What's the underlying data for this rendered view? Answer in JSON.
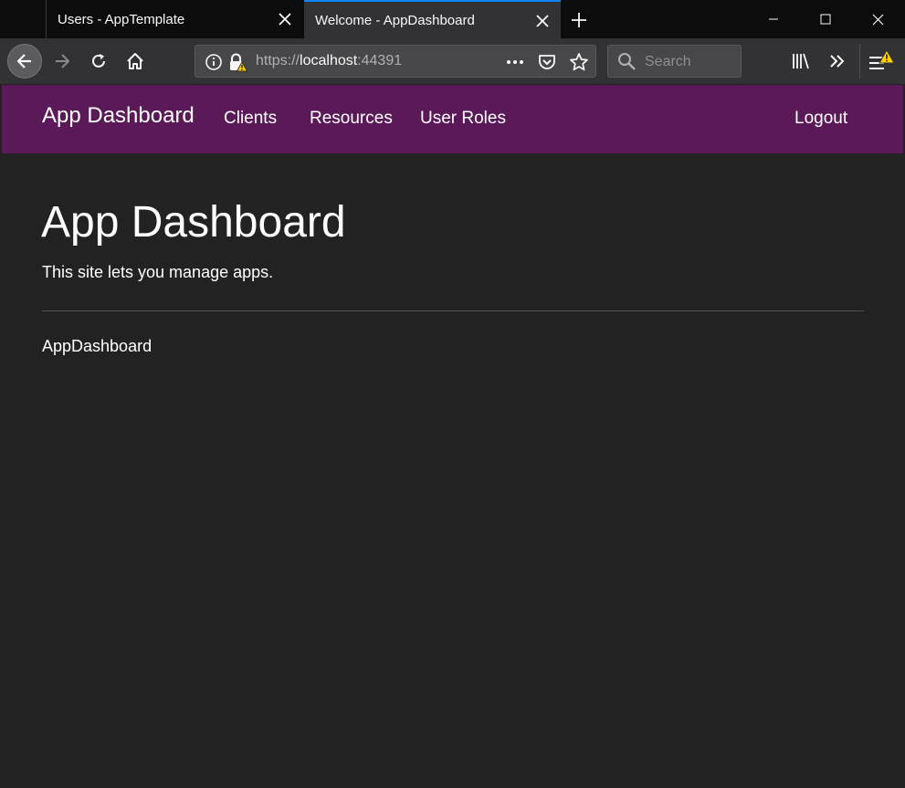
{
  "tabs": [
    {
      "title": "Users - AppTemplate",
      "active": false
    },
    {
      "title": "Welcome - AppDashboard",
      "active": true
    }
  ],
  "toolbar": {
    "url_scheme": "https://",
    "url_host": "localhost",
    "url_port": ":44391",
    "search_placeholder": "Search"
  },
  "navbar": {
    "brand": "App Dashboard",
    "links": [
      "Clients",
      "Resources",
      "User Roles"
    ],
    "logout": "Logout",
    "bg_color": "#5a1a58"
  },
  "main": {
    "heading": "App Dashboard",
    "lead": "This site lets you manage apps.",
    "footer": "AppDashboard"
  },
  "colors": {
    "accent": "#0a84ff",
    "warning": "#ffd200"
  }
}
